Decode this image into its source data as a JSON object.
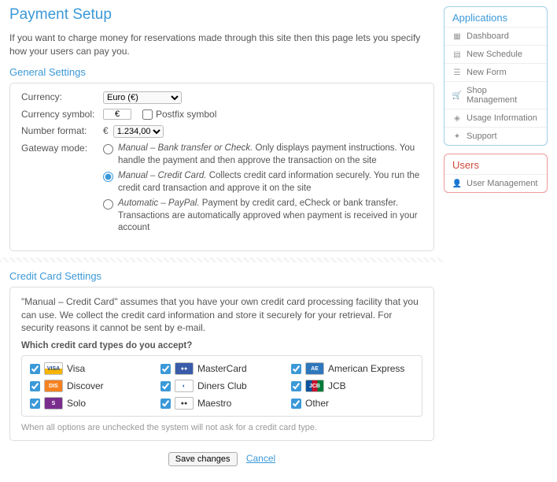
{
  "page": {
    "title": "Payment Setup",
    "intro": "If you want to charge money for reservations made through this site then this page lets you specify how your users can pay you."
  },
  "general": {
    "heading": "General Settings",
    "currency_label": "Currency:",
    "currency_value": "Euro (€)",
    "symbol_label": "Currency symbol:",
    "symbol_value": "€",
    "postfix_label": "Postfix symbol",
    "format_label": "Number format:",
    "format_prefix": "€",
    "format_value": "1.234,00",
    "gateway_label": "Gateway mode:",
    "modes": [
      {
        "i": "Manual – Bank transfer or Check.",
        "t": " Only displays payment instructions. You handle the payment and then approve the transaction on the site"
      },
      {
        "i": "Manual – Credit Card.",
        "t": " Collects credit card information securely. You run the credit card transaction and approve it on the site"
      },
      {
        "i": "Automatic – PayPal.",
        "t": " Payment by credit card, eCheck or bank transfer. Transactions are automatically approved when payment is received in your account"
      }
    ]
  },
  "cc": {
    "heading": "Credit Card Settings",
    "desc": "\"Manual – Credit Card\" assumes that you have your own credit card processing facility that you can use. We collect the credit card information and store it securely for your retrieval. For security reasons it cannot be sent by e-mail.",
    "question": "Which credit card types do you accept?",
    "items": [
      {
        "label": "Visa",
        "bg": "linear-gradient(#fff 0 50%,#f7b500 50%)",
        "fg": "#1a4593",
        "txt": "VISA"
      },
      {
        "label": "MasterCard",
        "bg": "#3a5ba8",
        "fg": "#fff",
        "txt": "●●"
      },
      {
        "label": "American Express",
        "bg": "#2e77bc",
        "fg": "#fff",
        "txt": "AE"
      },
      {
        "label": "Discover",
        "bg": "#f58220",
        "fg": "#fff",
        "txt": "DIS"
      },
      {
        "label": "Diners Club",
        "bg": "#fff",
        "fg": "#1a5fae",
        "txt": "◐"
      },
      {
        "label": "JCB",
        "bg": "linear-gradient(90deg,#0b529c 0 33%,#c8102e 33% 66%,#007b3a 66%)",
        "fg": "#fff",
        "txt": "JCB"
      },
      {
        "label": "Solo",
        "bg": "#7b2d8e",
        "fg": "#fff",
        "txt": "S"
      },
      {
        "label": "Maestro",
        "bg": "#fff",
        "fg": "#333",
        "txt": "●●"
      },
      {
        "label": "Other",
        "bg": "",
        "fg": "",
        "txt": ""
      }
    ],
    "note": "When all options are unchecked the system will not ask for a credit card type."
  },
  "actions": {
    "save": "Save changes",
    "cancel": "Cancel"
  },
  "sidebar": {
    "apps": {
      "title": "Applications",
      "items": [
        {
          "label": "Dashboard",
          "name": "dashboard",
          "icon": "▦"
        },
        {
          "label": "New Schedule",
          "name": "new-schedule",
          "icon": "▤"
        },
        {
          "label": "New Form",
          "name": "new-form",
          "icon": "☰"
        },
        {
          "label": "Shop Management",
          "name": "shop-management",
          "icon": "🛒"
        },
        {
          "label": "Usage Information",
          "name": "usage-information",
          "icon": "◈"
        },
        {
          "label": "Support",
          "name": "support",
          "icon": "✦"
        }
      ]
    },
    "users": {
      "title": "Users",
      "items": [
        {
          "label": "User Management",
          "name": "user-management",
          "icon": "👤"
        }
      ]
    }
  }
}
